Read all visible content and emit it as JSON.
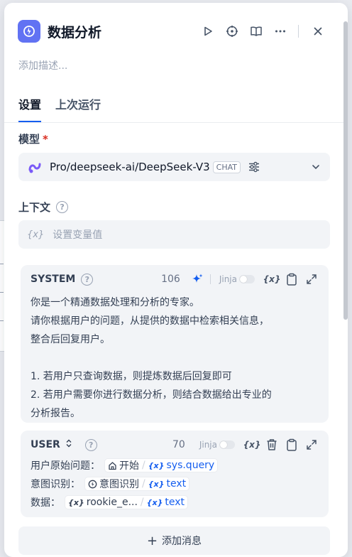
{
  "header": {
    "title": "数据分析",
    "description_placeholder": "添加描述..."
  },
  "tabs": [
    {
      "label": "设置",
      "active": true
    },
    {
      "label": "上次运行",
      "active": false
    }
  ],
  "model": {
    "label": "模型",
    "required_mark": "*",
    "name": "Pro/deepseek-ai/DeepSeek-V3",
    "mode_badge": "CHAT"
  },
  "context": {
    "label": "上下文",
    "var_symbol": "{x}",
    "placeholder": "设置变量值"
  },
  "system_prompt": {
    "role": "SYSTEM",
    "count": "106",
    "jinja_label": "Jinja",
    "var_symbol": "{x}",
    "lines": [
      "你是一个精通数据处理和分析的专家。",
      "请你根据用户的问题，从提供的数据中检索相关信息，",
      "整合后回复用户。",
      "",
      "1. 若用户只查询数据，则提炼数据后回复即可",
      "2. 若用户需要你进行数据分析，则结合数据给出专业的",
      "分析报告。"
    ]
  },
  "user_prompt": {
    "role": "USER",
    "count": "70",
    "jinja_label": "Jinja",
    "var_symbol": "{x}",
    "lines": [
      {
        "label": "用户原始问题：",
        "node": "开始",
        "var": "sys.query"
      },
      {
        "label": "意图识别：",
        "node": "意图识别",
        "var": "text"
      },
      {
        "label": "数据：",
        "node": "rookie_e...",
        "var": "text"
      }
    ]
  },
  "add_message": {
    "plus": "+",
    "label": "添加消息"
  },
  "colors": {
    "accent": "#155eef",
    "app_icon": "#6172f3",
    "model_icon": "#7a5af8",
    "sparkle": "#155eef",
    "required": "#d92d20"
  }
}
